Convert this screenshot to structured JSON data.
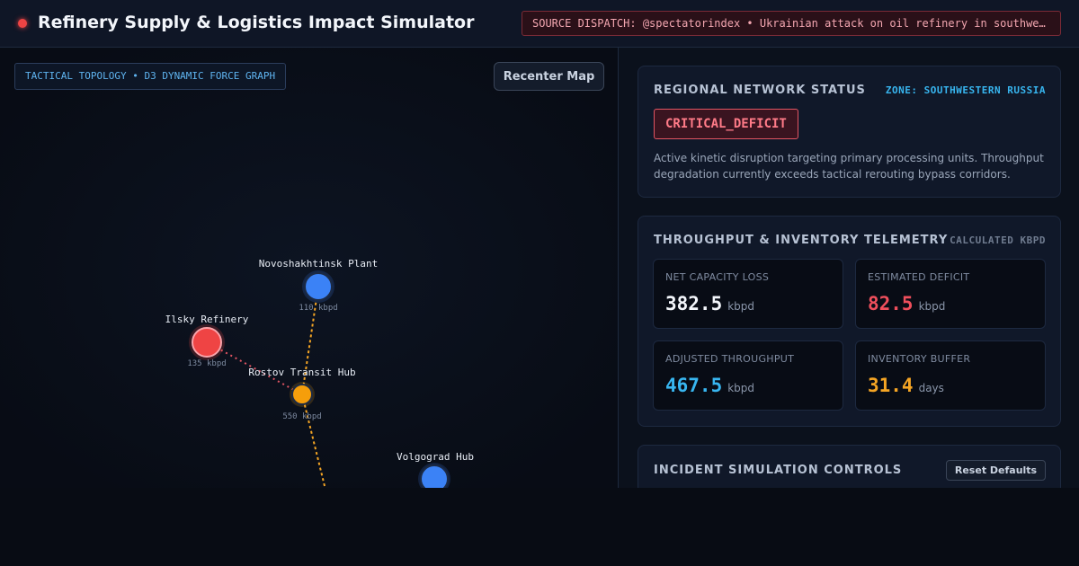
{
  "header": {
    "title": "Refinery Supply & Logistics Impact Simulator",
    "dispatch": "SOURCE DISPATCH: @spectatorindex • Ukrainian attack on oil refinery in southwestern Russia"
  },
  "map": {
    "tag": "TACTICAL TOPOLOGY • D3 DYNAMIC FORCE GRAPH",
    "recenter_label": "Recenter Map",
    "nodes": {
      "novoshakhtinsk": {
        "name": "Novoshakhtinsk Plant",
        "capacity": "110 kbpd",
        "color": "#3b82f6"
      },
      "ilsky": {
        "name": "Ilsky Refinery",
        "capacity": "135 kbpd",
        "color": "#ef4444"
      },
      "rostov": {
        "name": "Rostov Transit Hub",
        "capacity": "550 kbpd",
        "color": "#f59e0b"
      },
      "volgograd": {
        "name": "Volgograd Hub",
        "capacity": "",
        "color": "#3b82f6"
      }
    }
  },
  "status_card": {
    "title": "REGIONAL NETWORK STATUS",
    "zone": "ZONE: SOUTHWESTERN RUSSIA",
    "badge": "CRITICAL_DEFICIT",
    "description": "Active kinetic disruption targeting primary processing units. Throughput degradation currently exceeds tactical rerouting bypass corridors."
  },
  "telemetry": {
    "title": "THROUGHPUT & INVENTORY TELEMETRY",
    "meta": "CALCULATED KBPD",
    "metrics": {
      "net_capacity_loss": {
        "label": "NET CAPACITY LOSS",
        "value": "382.5",
        "unit": "kbpd",
        "color": "#f3f6fb"
      },
      "estimated_deficit": {
        "label": "ESTIMATED DEFICIT",
        "value": "82.5",
        "unit": "kbpd",
        "color": "#ef4f5c"
      },
      "adjusted_throughput": {
        "label": "ADJUSTED THROUGHPUT",
        "value": "467.5",
        "unit": "kbpd",
        "color": "#38b6f0"
      },
      "inventory_buffer": {
        "label": "INVENTORY BUFFER",
        "value": "31.4",
        "unit": "days",
        "color": "#f5a524"
      }
    }
  },
  "controls": {
    "title": "INCIDENT SIMULATION CONTROLS",
    "reset_label": "Reset Defaults"
  },
  "colors": {
    "critical": "#ef4444",
    "accent": "#38b6f0",
    "warning": "#f59e0b"
  }
}
